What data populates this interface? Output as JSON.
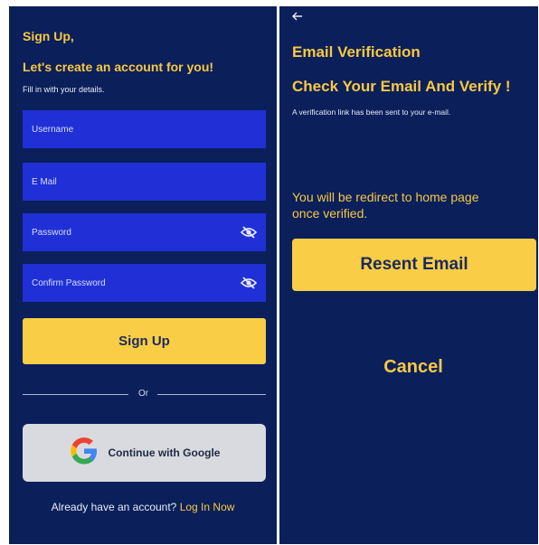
{
  "signup": {
    "heading": "Sign Up,",
    "subheading": "Let's create an account for you!",
    "instruction": "Fill in with your details.",
    "fields": {
      "username_placeholder": "Username",
      "email_placeholder": "E Mail",
      "password_placeholder": "Password",
      "confirm_password_placeholder": "Confirm Password"
    },
    "signup_button": "Sign Up",
    "divider_text": "Or",
    "google_button": "Continue with Google",
    "login_prompt": "Already have an account?",
    "login_link": "Log In Now"
  },
  "verification": {
    "back_icon": "arrow-left-icon",
    "title": "Email Verification",
    "subtitle": "Check Your Email And Verify !",
    "message": "A verification link has been sent to your e-mail.",
    "redirect_line1": "You will be redirect to home page",
    "redirect_line2": "once verified.",
    "resend_button": "Resent Email",
    "cancel_button": "Cancel"
  },
  "colors": {
    "background": "#0b1f5b",
    "accent_yellow": "#f9cd46",
    "field_blue": "#2030d6",
    "google_button_bg": "#d9dadf"
  }
}
